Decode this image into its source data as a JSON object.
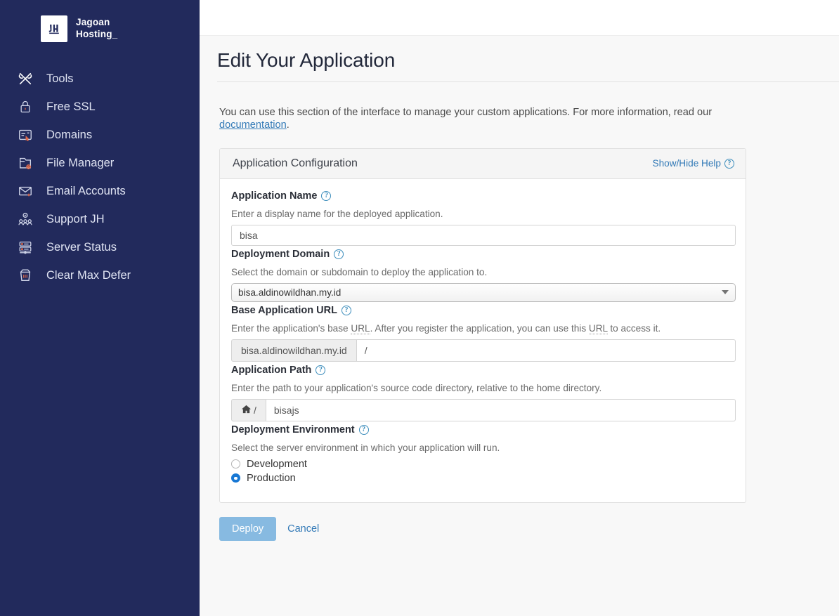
{
  "sidebar": {
    "brand": {
      "line1": "Jagoan",
      "line2": "Hosting_",
      "logo_alt": "jagoan-hosting-logo"
    },
    "items": [
      {
        "label": "Tools",
        "icon": "tools-icon"
      },
      {
        "label": "Free SSL",
        "icon": "lock-icon"
      },
      {
        "label": "Domains",
        "icon": "domain-card-icon"
      },
      {
        "label": "File Manager",
        "icon": "folder-icon"
      },
      {
        "label": "Email Accounts",
        "icon": "envelope-icon"
      },
      {
        "label": "Support JH",
        "icon": "people-icon"
      },
      {
        "label": "Server Status",
        "icon": "server-icon"
      },
      {
        "label": "Clear Max Defer",
        "icon": "trash-icon"
      }
    ]
  },
  "page": {
    "title": "Edit Your Application",
    "intro_before_link": "You can use this section of the interface to manage your custom applications. For more information, read our ",
    "intro_link": "documentation",
    "intro_after_link": "."
  },
  "panel": {
    "title": "Application Configuration",
    "help_toggle": "Show/Hide Help",
    "help_icon": "question-circle-icon"
  },
  "fields": {
    "app_name": {
      "label": "Application Name",
      "hint": "Enter a display name for the deployed application.",
      "value": "bisa",
      "placeholder": ""
    },
    "deployment_domain": {
      "label": "Deployment Domain",
      "hint": "Select the domain or subdomain to deploy the application to.",
      "selected": "bisa.aldinowildhan.my.id",
      "options": [
        "bisa.aldinowildhan.my.id"
      ]
    },
    "base_url": {
      "label": "Base Application URL",
      "hint_part1": "Enter the application's base ",
      "hint_abbr1": "URL",
      "hint_part2": ". After you register the application, you can use this ",
      "hint_abbr2": "URL",
      "hint_part3": " to access it.",
      "addon": "bisa.aldinowildhan.my.id",
      "value": "/",
      "placeholder": ""
    },
    "app_path": {
      "label": "Application Path",
      "hint": "Enter the path to your application's source code directory, relative to the home directory.",
      "addon_icon": "home-icon",
      "addon_text": "/",
      "value": "bisajs",
      "placeholder": ""
    },
    "deployment_environment": {
      "label": "Deployment Environment",
      "hint": "Select the server environment in which your application will run.",
      "options": [
        {
          "label": "Development",
          "checked": false
        },
        {
          "label": "Production",
          "checked": true
        }
      ]
    }
  },
  "actions": {
    "deploy": "Deploy",
    "cancel": "Cancel"
  },
  "colors": {
    "sidebar_bg": "#222a5c",
    "link": "#337ab7",
    "primary_button": "#87bae1",
    "radio_checked": "#1878d4",
    "content_bg": "#f8f8f8"
  }
}
